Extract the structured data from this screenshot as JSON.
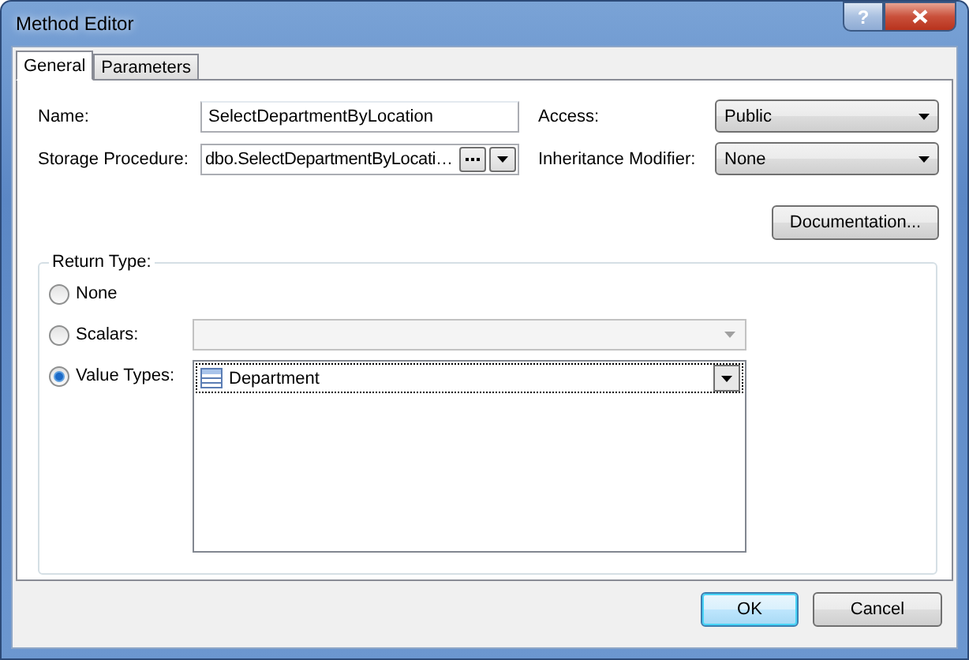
{
  "window": {
    "title": "Method Editor",
    "help": "?"
  },
  "tabs": [
    {
      "label": "General",
      "selected": true
    },
    {
      "label": "Parameters",
      "selected": false
    }
  ],
  "fields": {
    "name": {
      "label": "Name:",
      "value": "SelectDepartmentByLocation"
    },
    "storage_procedure": {
      "label": "Storage Procedure:",
      "value": "dbo.SelectDepartmentByLocati…"
    },
    "access": {
      "label": "Access:",
      "value": "Public"
    },
    "inheritance_modifier": {
      "label": "Inheritance Modifier:",
      "value": "None"
    }
  },
  "documentation_button": "Documentation...",
  "return_type": {
    "title": "Return Type:",
    "options": [
      {
        "kind": "plain",
        "label": "None",
        "selected": false
      },
      {
        "kind": "combo",
        "label": "Scalars:",
        "selected": false,
        "disabled": true
      },
      {
        "kind": "list",
        "label": "Value Types:",
        "selected": true,
        "value": "Department"
      }
    ]
  },
  "buttons": [
    {
      "label": "OK",
      "default": true
    },
    {
      "label": "Cancel",
      "default": false
    }
  ]
}
